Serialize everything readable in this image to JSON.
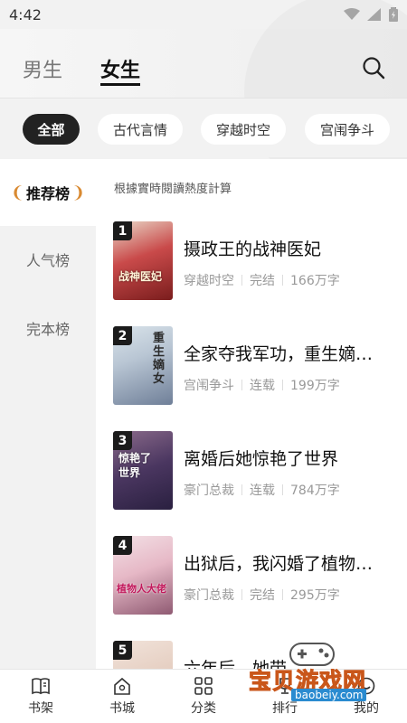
{
  "status_bar": {
    "time": "4:42"
  },
  "header": {
    "tabs": [
      {
        "label": "男生"
      },
      {
        "label": "女生"
      }
    ],
    "active_tab": "女生"
  },
  "categories": [
    "全部",
    "古代言情",
    "穿越时空",
    "宫闱争斗"
  ],
  "active_category": "全部",
  "sidebar": {
    "items": [
      "推荐榜",
      "人气榜",
      "完本榜"
    ],
    "active": "推荐榜"
  },
  "ranking_note": "根據實時閱讀熱度計算",
  "books": [
    {
      "rank": "1",
      "title": "摄政王的战神医妃",
      "genre": "穿越时空",
      "status": "完结",
      "words": "166万字",
      "cover_text": "战神医妃"
    },
    {
      "rank": "2",
      "title": "全家夺我军功，重生嫡…",
      "genre": "宫闱争斗",
      "status": "连载",
      "words": "199万字",
      "cover_text": "重生嫡女"
    },
    {
      "rank": "3",
      "title": "离婚后她惊艳了世界",
      "genre": "豪门总裁",
      "status": "连载",
      "words": "784万字",
      "cover_text": "惊艳了世界"
    },
    {
      "rank": "4",
      "title": "出狱后，我闪婚了植物…",
      "genre": "豪门总裁",
      "status": "完结",
      "words": "295万字",
      "cover_text": "植物人大佬"
    },
    {
      "rank": "5",
      "title": "六年后，她带…",
      "genre": "",
      "status": "",
      "words": "",
      "cover_text": ""
    }
  ],
  "bottom_nav": [
    "书架",
    "书城",
    "分类",
    "排行",
    "我的"
  ],
  "watermark": {
    "text": "宝贝游戏网",
    "url": "baobeiy.com"
  },
  "colors": {
    "accent": "#222222",
    "badge": "#1b1b1b",
    "laurel": "#d98a32"
  }
}
